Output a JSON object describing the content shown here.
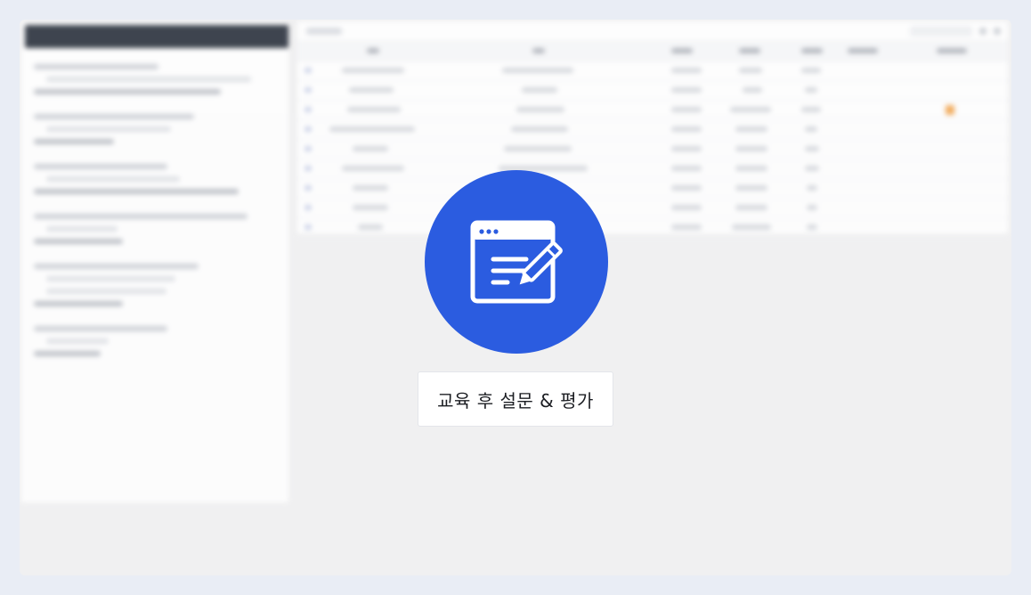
{
  "overlay": {
    "label": "교육 후 설문 & 평가",
    "icon": "survey-form-edit-icon",
    "accent_color": "#2b5ce0"
  },
  "background": {
    "state": "blurred",
    "left_panel": {
      "section_count": 6
    },
    "table": {
      "row_count": 9,
      "flag_color": "#f2a247"
    }
  }
}
